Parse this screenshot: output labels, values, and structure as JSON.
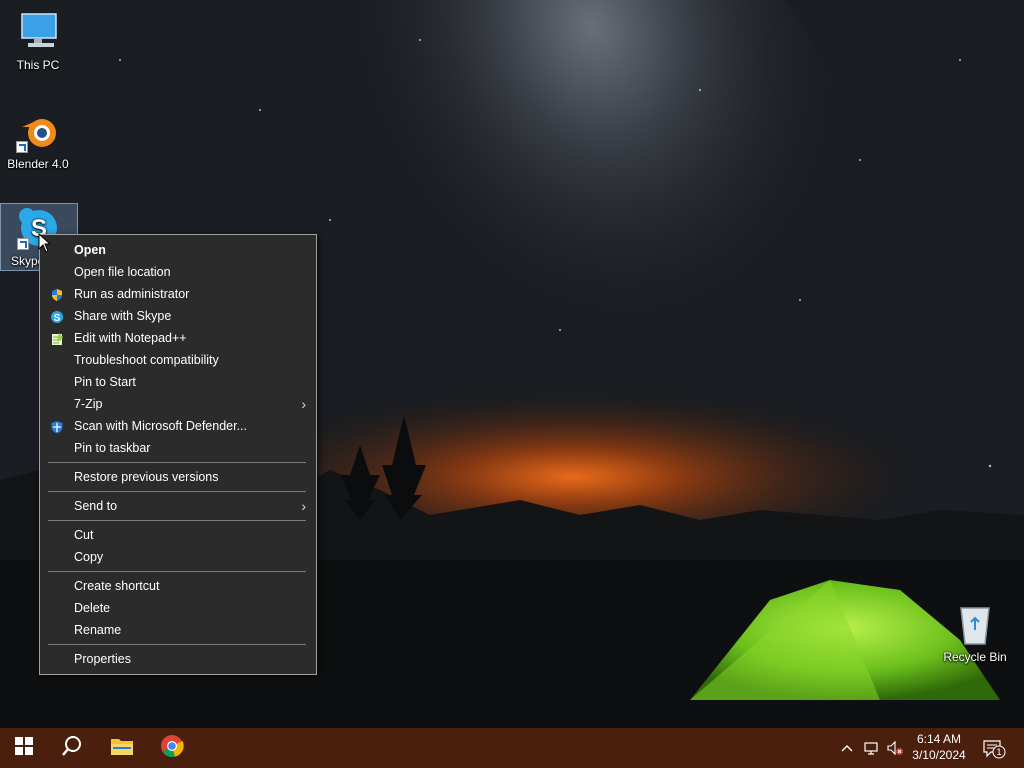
{
  "desktop": {
    "icons": [
      {
        "label": "This PC",
        "icon": "this-pc-icon"
      },
      {
        "label": "Blender 4.0",
        "icon": "blender-icon"
      },
      {
        "label": "Skype",
        "icon": "skype-icon"
      },
      {
        "label": "Recycle Bin",
        "icon": "recycle-bin-icon"
      }
    ]
  },
  "context_menu": {
    "items": [
      {
        "label": "Open",
        "bold": true
      },
      {
        "label": "Open file location"
      },
      {
        "label": "Run as administrator",
        "icon": "uac-shield-icon"
      },
      {
        "label": "Share with Skype",
        "icon": "skype-icon"
      },
      {
        "label": "Edit with Notepad++",
        "icon": "notepadpp-icon"
      },
      {
        "label": "Troubleshoot compatibility"
      },
      {
        "label": "Pin to Start"
      },
      {
        "label": "7-Zip",
        "submenu": true
      },
      {
        "label": "Scan with Microsoft Defender...",
        "icon": "defender-icon"
      },
      {
        "label": "Pin to taskbar"
      },
      {
        "label": "Restore previous versions"
      },
      {
        "label": "Send to",
        "submenu": true
      },
      {
        "label": "Cut"
      },
      {
        "label": "Copy"
      },
      {
        "label": "Create shortcut"
      },
      {
        "label": "Delete"
      },
      {
        "label": "Rename"
      },
      {
        "label": "Properties"
      }
    ],
    "submenu_arrow": "›"
  },
  "taskbar": {
    "buttons": [
      {
        "name": "start-button",
        "icon": "windows-icon"
      },
      {
        "name": "search-button",
        "icon": "search-icon"
      },
      {
        "name": "file-explorer-button",
        "icon": "folder-icon"
      },
      {
        "name": "chrome-button",
        "icon": "chrome-icon"
      }
    ],
    "clock": {
      "time": "6:14 AM",
      "date": "3/10/2024"
    },
    "notification_count": "1",
    "colors": {
      "background": "#4a1f0d",
      "accent": "#2b2b2b"
    }
  }
}
